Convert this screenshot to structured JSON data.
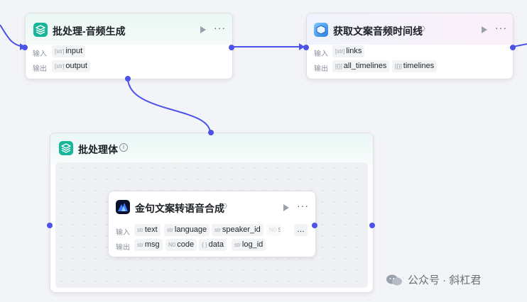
{
  "labels": {
    "input": "输入",
    "output": "输出"
  },
  "nodes": {
    "audio_gen": {
      "title": "批处理-音频生成",
      "inputs": [
        {
          "type": "[str]",
          "name": "input"
        }
      ],
      "outputs": [
        {
          "type": "[str]",
          "name": "output"
        }
      ]
    },
    "timeline": {
      "title": "获取文案音频时间线",
      "inputs": [
        {
          "type": "[str]",
          "name": "links"
        }
      ],
      "outputs": [
        {
          "type": "[{}]",
          "name": "all_timelines"
        },
        {
          "type": "[{}]",
          "name": "timelines"
        }
      ]
    },
    "batch_body": {
      "title": "批处理体"
    },
    "tts": {
      "title": "金句文案转语音合成",
      "inputs": [
        {
          "type": "str",
          "name": "text"
        },
        {
          "type": "str",
          "name": "language"
        },
        {
          "type": "str",
          "name": "speaker_id"
        },
        {
          "type": "N0",
          "name": "s"
        }
      ],
      "outputs": [
        {
          "type": "str",
          "name": "msg"
        },
        {
          "type": "N0",
          "name": "code"
        },
        {
          "type": "{ }",
          "name": "data"
        },
        {
          "type": "str",
          "name": "log_id"
        }
      ],
      "more_inputs": "…"
    }
  },
  "icons": {
    "batch": "stack-layers-icon",
    "timeline": "app-cube-icon",
    "tts": "mountain-logo-icon",
    "run": "play-icon",
    "more": "more-dots-icon",
    "plugin": "plugin-icon",
    "info": "info-icon"
  },
  "colors": {
    "accent": "#4d53e8",
    "batch_icon": "#17b69b"
  },
  "watermark": {
    "text": "公众号 · 斜杠君"
  }
}
